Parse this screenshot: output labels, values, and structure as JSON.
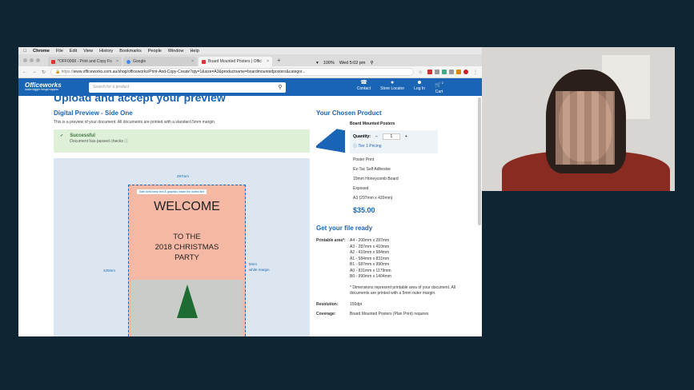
{
  "menubar": {
    "apple": "",
    "app": "Chrome",
    "items": [
      "File",
      "Edit",
      "View",
      "History",
      "Bookmarks",
      "People",
      "Window",
      "Help"
    ],
    "battery": "100%",
    "clock": "Wed 5:02 pm"
  },
  "tabs": [
    {
      "label": "*OFF0068 - Print and Copy Fo",
      "active": false
    },
    {
      "label": "Google",
      "active": false
    },
    {
      "label": "Board Mounted Posters | Offic",
      "active": true
    }
  ],
  "address": {
    "scheme": "https://",
    "url": "www.officeworks.com.au/shop/officeworks/Print-And-Copy-Create?qty=1&size=A3&productname=boardmountedposters&categor..."
  },
  "site": {
    "logo": "Officeworks",
    "tagline": "make bigger things happen",
    "search_placeholder": "Search for a product",
    "nav": [
      "Contact",
      "Store Locator",
      "Log In",
      "Cart"
    ],
    "cart_count": "2"
  },
  "page": {
    "cut_heading": "Upload and accept your preview",
    "preview_title": "Digital Preview - Side One",
    "preview_note": "This is a preview of your document. All documents are printed with a standard 5mm margin.",
    "success_title": "Successful",
    "success_text": "Document has passed checks",
    "width_label": "297mm",
    "height_label": "420mm",
    "margin_label": "5mm",
    "margin_sub": "white margin",
    "safe_area": "Safe Area   keep text & graphics inside the dotted line",
    "poster_title": "WELCOME",
    "poster_line1": "TO THE",
    "poster_line2": "2018 CHRISTMAS",
    "poster_line3": "PARTY"
  },
  "product": {
    "heading": "Your Chosen Product",
    "name": "Board Mounted Posters",
    "quantity_label": "Quantity:",
    "quantity": "1",
    "tier": "Tier 1 Pricing",
    "options": [
      "Poster Print",
      "Ez-Tac Self Adhesive",
      "10mm Honeycomb Board",
      "Exposed",
      "A3 (297mm x 420mm)"
    ],
    "price": "$35.00"
  },
  "ready": {
    "heading": "Get your file ready",
    "printable_label": "Printable area*:",
    "sizes": [
      "A4 - 200mm x 287mm",
      "A3 - 287mm x 410mm",
      "A2 - 410mm x 584mm",
      "A1 - 584mm x 831mm",
      "B1 - 687mm x 990mm",
      "A0 - 831mm x 1179mm",
      "B0 - 990mm x 1404mm"
    ],
    "footnote": "* Dimensions represent printable area of your document. All documents are printed with a 5mm outer margin.",
    "resolution_label": "Resolution:",
    "resolution": "150dpi",
    "coverage_label": "Coverage:",
    "coverage": "Board Mounted Posters (Plan Print) requires"
  },
  "colors": {
    "brand": "#1a64b5",
    "background": "#0f2533"
  }
}
